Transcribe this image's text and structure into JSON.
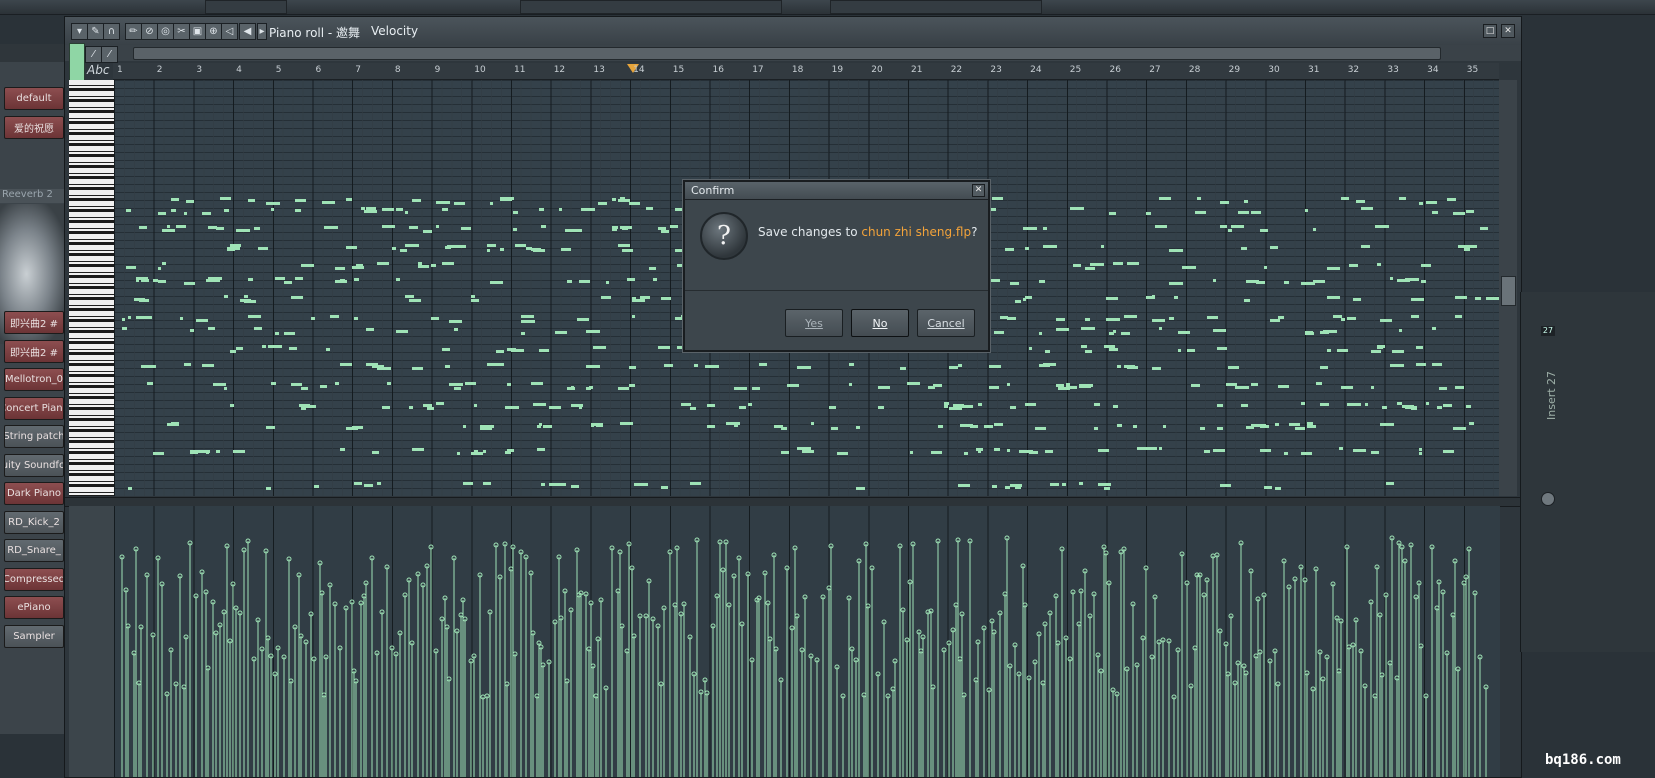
{
  "window": {
    "title": "Piano roll - 邀舞",
    "target": "Velocity",
    "abc_label": "Abc"
  },
  "ruler": {
    "bars": [
      "1",
      "2",
      "3",
      "4",
      "5",
      "6",
      "7",
      "8",
      "9",
      "10",
      "11",
      "12",
      "13",
      "14",
      "15",
      "16",
      "17",
      "18",
      "19",
      "20",
      "21",
      "22",
      "23",
      "24",
      "25",
      "26",
      "27",
      "28",
      "29",
      "30",
      "31",
      "32",
      "33",
      "34",
      "35"
    ]
  },
  "channels": {
    "preset_top": "default",
    "pattern_name": "爱的祝愿",
    "plugin_label": "Reeverb 2",
    "items": [
      {
        "label": "即兴曲2 #",
        "style": "red"
      },
      {
        "label": "即兴曲2 #",
        "style": "red"
      },
      {
        "label": "Mellotron_0",
        "style": "red"
      },
      {
        "label": "Concert Piano",
        "style": "red"
      },
      {
        "label": "String patch",
        "style": "gray"
      },
      {
        "label": "Fruity Soundfont",
        "style": "gray"
      },
      {
        "label": "Dark Piano",
        "style": "red"
      },
      {
        "label": "RD_Kick_2",
        "style": "gray"
      },
      {
        "label": "RD_Snare_",
        "style": "gray"
      },
      {
        "label": "Compressed",
        "style": "red"
      },
      {
        "label": "ePiano",
        "style": "red"
      },
      {
        "label": "Sampler",
        "style": "gray"
      }
    ]
  },
  "dialog": {
    "title": "Confirm",
    "message_prefix": "Save changes to ",
    "filename": "chun zhi sheng.flp",
    "message_suffix": "?",
    "buttons": {
      "yes": "Yes",
      "no": "No",
      "cancel": "Cancel"
    },
    "icon": "question-icon",
    "close_icon": "close-icon"
  },
  "mixer": {
    "insert_label": "Insert 27",
    "level_readout": "27"
  },
  "watermark": "bq186.com",
  "colors": {
    "note": "#9fe3b6",
    "accent_file": "#f3a33a",
    "playhead": "#e7a53b",
    "channel_red": "#7c4244"
  }
}
